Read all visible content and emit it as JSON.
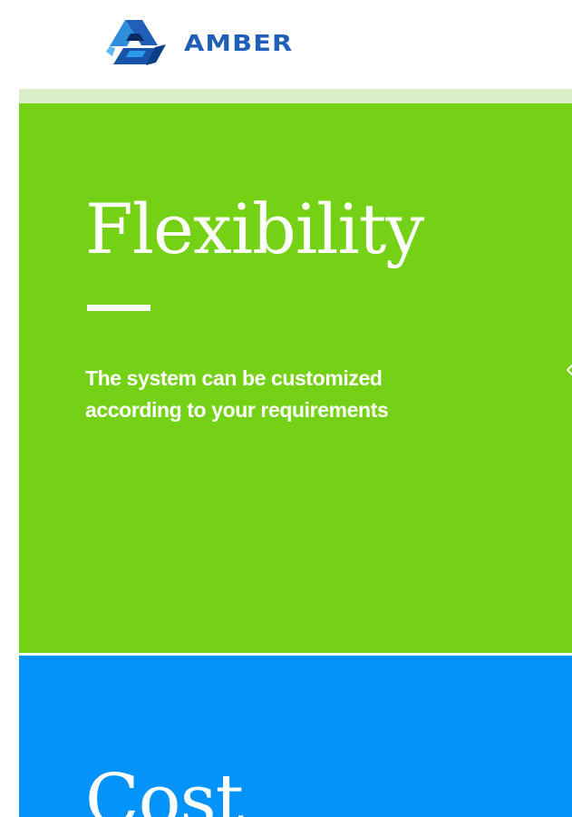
{
  "header": {
    "logo": {
      "name": "AMBER",
      "icon": "amber-cube-logo-icon"
    }
  },
  "features": [
    {
      "title": "Flexibility",
      "description_line1": "The system can be customized",
      "description_line2": "according to your requirements",
      "color": "#75d115"
    },
    {
      "title": "Cost",
      "color": "#0492fb"
    }
  ],
  "navigation": {
    "side_arrow_icon": "chevron-left-icon"
  },
  "colors": {
    "logo_blue": "#1f5fb7",
    "logo_light_blue": "#2c9ae8",
    "accent_strip": "#d9edc8",
    "text": "#ffffff"
  }
}
